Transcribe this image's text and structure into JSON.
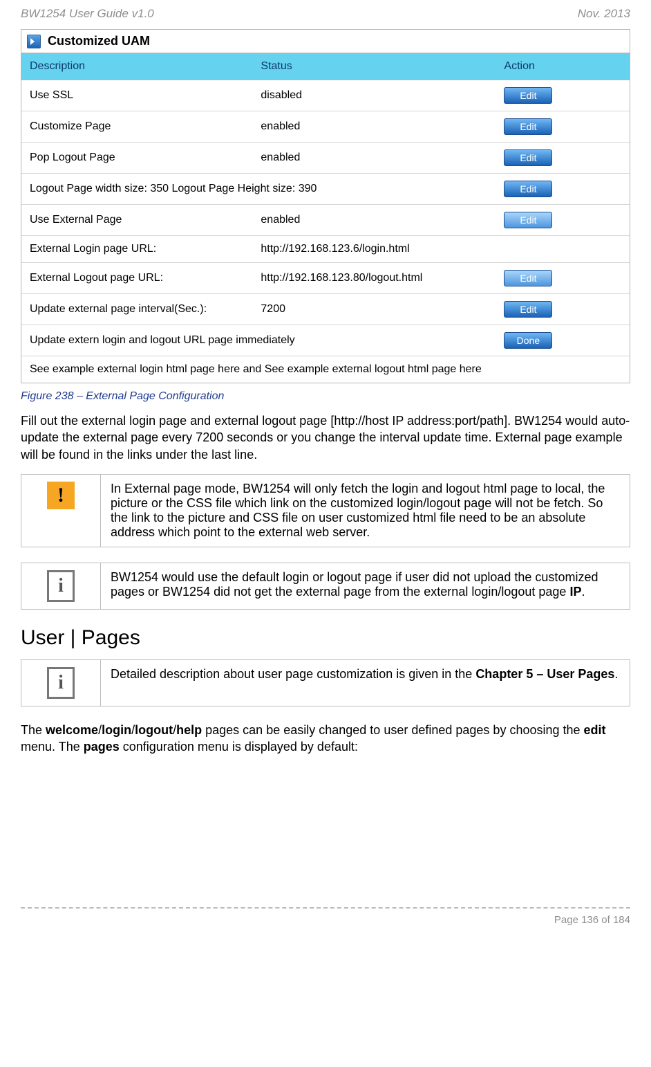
{
  "header": {
    "left": "BW1254 User Guide v1.0",
    "right": "Nov.  2013"
  },
  "panel": {
    "title": "Customized UAM",
    "columns": {
      "c1": "Description",
      "c2": "Status",
      "c3": "Action"
    },
    "rows": {
      "r1": {
        "desc": "Use SSL",
        "status": "disabled",
        "btn": "Edit"
      },
      "r2": {
        "desc": "Customize Page",
        "status": "enabled",
        "btn": "Edit"
      },
      "r3": {
        "desc": "Pop Logout Page",
        "status": "enabled",
        "btn": "Edit"
      },
      "r4": {
        "desc": "Logout Page width size: 350  Logout Page Height size: 390",
        "btn": "Edit"
      },
      "r5": {
        "desc": "Use External Page",
        "status": "enabled",
        "btn": "Edit"
      },
      "r6": {
        "desc": "External Login page URL:",
        "status": "http://192.168.123.6/login.html"
      },
      "r7": {
        "desc": "External Logout page URL:",
        "status": "http://192.168.123.80/logout.html",
        "btn": "Edit"
      },
      "r8": {
        "desc": "Update external page interval(Sec.):",
        "status": "7200",
        "btn": "Edit"
      },
      "r9": {
        "desc": "Update extern login and logout URL page immediately",
        "btn": "Done"
      },
      "r10": {
        "desc": "See example external login html page here and See example external logout html page here"
      }
    }
  },
  "caption": "Figure 238 – External Page Configuration",
  "para1": "Fill out the external login page and external logout page [http://host IP address:port/path]. BW1254 would auto-update the external page every 7200 seconds or you change the interval update time. External page example will be found in the links under the last line.",
  "note_warn": "In External page mode, BW1254 will only fetch the login and logout html page to local, the picture or the CSS file which link on the customized login/logout page will not be fetch. So the link to the picture and CSS file on user customized html file need to be an absolute address which point to the external web server.",
  "note_info1_a": "BW1254 would use the default login or logout page if user did not upload the customized pages or BW1254 did not get the external page from the external login/logout page ",
  "note_info1_b": "IP",
  "note_info1_c": ".",
  "section": "User | Pages",
  "note_info2_a": "Detailed description about user page customization is given in the ",
  "note_info2_b": "Chapter 5 – User Pages",
  "note_info2_c": ".",
  "para2_a": "The ",
  "para2_b": "welcome",
  "para2_s": "/",
  "para2_c": "login",
  "para2_d": "logout",
  "para2_e": "help",
  "para2_f": " pages can be easily changed to user defined pages by choosing the ",
  "para2_g": "edit",
  "para2_h": " menu. The ",
  "para2_i": "pages",
  "para2_j": " configuration menu is displayed by default:",
  "footer": "Page 136 of 184"
}
